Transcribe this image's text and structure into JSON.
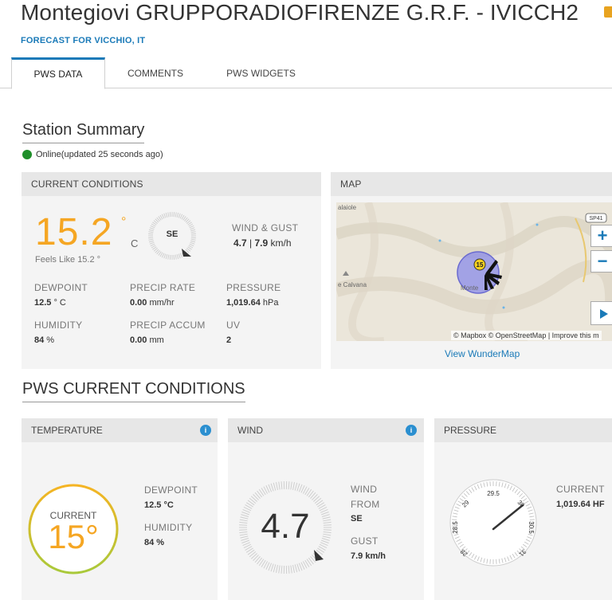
{
  "header": {
    "title": "Montegiovi GRUPPORADIOFIRENZE G.R.F. - IVICCH2",
    "forecast_link": "FORECAST FOR VICCHIO, IT"
  },
  "tabs": [
    {
      "label": "PWS DATA",
      "active": true
    },
    {
      "label": "COMMENTS",
      "active": false
    },
    {
      "label": "PWS WIDGETS",
      "active": false
    }
  ],
  "summary": {
    "title": "Station Summary",
    "status": "Online(updated 25 seconds ago)",
    "status_color": "#1f8f2a"
  },
  "current_conditions": {
    "header": "CURRENT CONDITIONS",
    "temperature": "15.2",
    "degree": "°",
    "unit": "C",
    "feels_like": "Feels Like 15.2 °",
    "wind_direction": "SE",
    "wind_gust_label": "WIND & GUST",
    "wind_speed": "4.7",
    "wind_separator": " | ",
    "wind_gust": "7.9",
    "wind_unit": " km/h",
    "dewpoint_label": "DEWPOINT",
    "dewpoint_value": "12.5",
    "dewpoint_unit": " ° C",
    "precip_rate_label": "PRECIP RATE",
    "precip_rate_value": "0.00",
    "precip_rate_unit": " mm/hr",
    "pressure_label": "PRESSURE",
    "pressure_value": "1,019.64",
    "pressure_unit": " hPa",
    "humidity_label": "HUMIDITY",
    "humidity_value": "84",
    "humidity_unit": " %",
    "precip_accum_label": "PRECIP ACCUM",
    "precip_accum_value": "0.00",
    "precip_accum_unit": " mm",
    "uv_label": "UV",
    "uv_value": "2"
  },
  "map": {
    "header": "MAP",
    "place_1": "alaiole",
    "place_2": "e Calvana",
    "place_3": "Monte",
    "road_badge": "SP41",
    "station_badge": "15",
    "attribution": "© Mapbox © OpenStreetMap | Improve this m",
    "zoom_in": "+",
    "zoom_out": "−",
    "link": "View WunderMap"
  },
  "pws_current": {
    "title": "PWS CURRENT CONDITIONS",
    "temperature_card": {
      "header": "TEMPERATURE",
      "current_label": "CURRENT",
      "current_value": "15°",
      "dewpoint_label": "DEWPOINT",
      "dewpoint_value": "12.5 °C",
      "humidity_label": "HUMIDITY",
      "humidity_value": "84 %"
    },
    "wind_card": {
      "header": "WIND",
      "speed": "4.7",
      "from_label_1": "WIND",
      "from_label_2": "FROM",
      "from_value": "SE",
      "gust_label": "GUST",
      "gust_value": "7.9 km/h"
    },
    "pressure_card": {
      "header": "PRESSURE",
      "current_label": "CURRENT",
      "current_value": "1,019.64 HF",
      "ticks": [
        "29.5",
        "29",
        "30",
        "28.5",
        "30.5",
        "28",
        "31"
      ]
    },
    "info_icon": "i"
  },
  "colors": {
    "accent_blue": "#1a7ab8",
    "temp_orange": "#f5a623",
    "online_green": "#1f8f2a"
  }
}
